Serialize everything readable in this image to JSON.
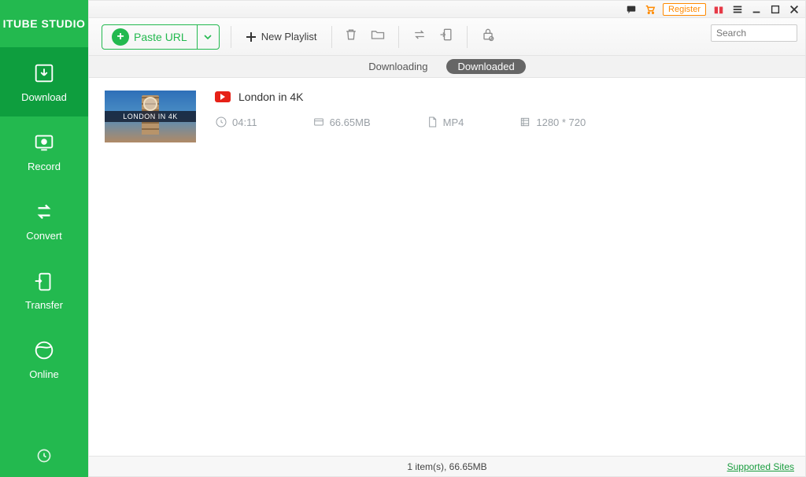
{
  "app_name": "ITUBE STUDIO",
  "sidebar": {
    "items": [
      "Download",
      "Record",
      "Convert",
      "Transfer",
      "Online"
    ]
  },
  "titlebar": {
    "register": "Register"
  },
  "toolbar": {
    "paste_url": "Paste URL",
    "new_playlist": "New Playlist",
    "search_placeholder": "Search"
  },
  "tabs": {
    "downloading": "Downloading",
    "downloaded": "Downloaded"
  },
  "items": [
    {
      "title": "London in 4K",
      "thumb_text": "LONDON IN 4K",
      "duration": "04:11",
      "size": "66.65MB",
      "format": "MP4",
      "resolution": "1280 * 720"
    }
  ],
  "statusbar": {
    "summary": "1 item(s), 66.65MB",
    "supported_sites": "Supported Sites"
  }
}
